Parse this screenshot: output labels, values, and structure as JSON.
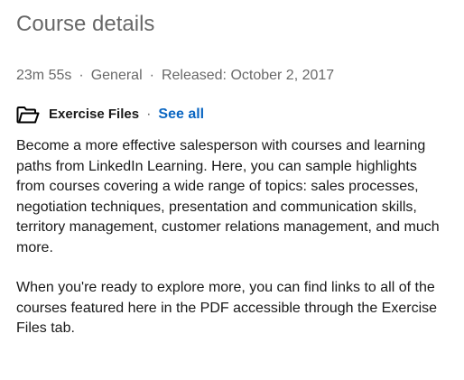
{
  "header": {
    "title": "Course details"
  },
  "meta": {
    "duration": "23m 55s",
    "separator": "·",
    "level": "General",
    "released": "Released: October 2, 2017"
  },
  "exercise_files": {
    "icon": "folder-icon",
    "label": "Exercise Files",
    "separator": "·",
    "see_all_label": "See all",
    "link_color": "#0a66c2"
  },
  "description": {
    "paragraphs": [
      "Become a more effective salesperson with courses and learning paths from LinkedIn Learning. Here, you can sample highlights from courses covering a wide range of topics: sales processes, negotiation techniques, presentation and communication skills, territory management, customer relations management, and much more.",
      "When you're ready to explore more, you can find links to all of the courses featured here in the PDF accessible through the Exercise Files tab."
    ]
  }
}
